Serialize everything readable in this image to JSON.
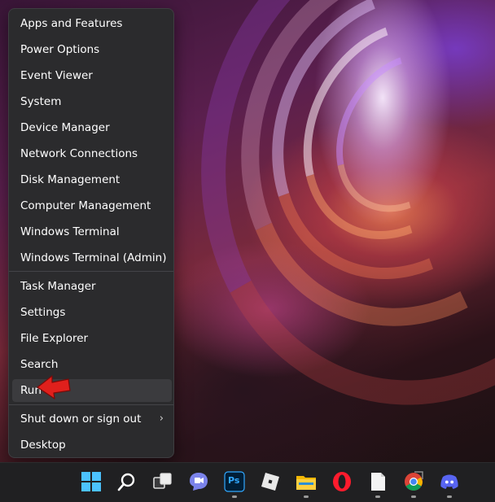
{
  "menu": {
    "items": [
      {
        "label": "Apps and Features"
      },
      {
        "label": "Power Options"
      },
      {
        "label": "Event Viewer"
      },
      {
        "label": "System"
      },
      {
        "label": "Device Manager"
      },
      {
        "label": "Network Connections"
      },
      {
        "label": "Disk Management"
      },
      {
        "label": "Computer Management"
      },
      {
        "label": "Windows Terminal"
      },
      {
        "label": "Windows Terminal (Admin)"
      },
      {
        "label": "Task Manager"
      },
      {
        "label": "Settings"
      },
      {
        "label": "File Explorer"
      },
      {
        "label": "Search"
      },
      {
        "label": "Run"
      },
      {
        "label": "Shut down or sign out"
      },
      {
        "label": "Desktop"
      }
    ]
  },
  "taskbar": {
    "icons": [
      "windows-start-icon",
      "search-icon",
      "task-view-icon",
      "teams-chat-icon",
      "photoshop-icon",
      "roblox-icon",
      "file-explorer-icon",
      "opera-icon",
      "notepad-icon",
      "chrome-icon",
      "discord-icon"
    ],
    "photoshop_text": "Ps"
  },
  "colors": {
    "menu_bg": "#2b2b2d",
    "hover_bg": "#3b3b3e",
    "arrow": "#e0201c",
    "taskbar_bg": "#202022"
  }
}
